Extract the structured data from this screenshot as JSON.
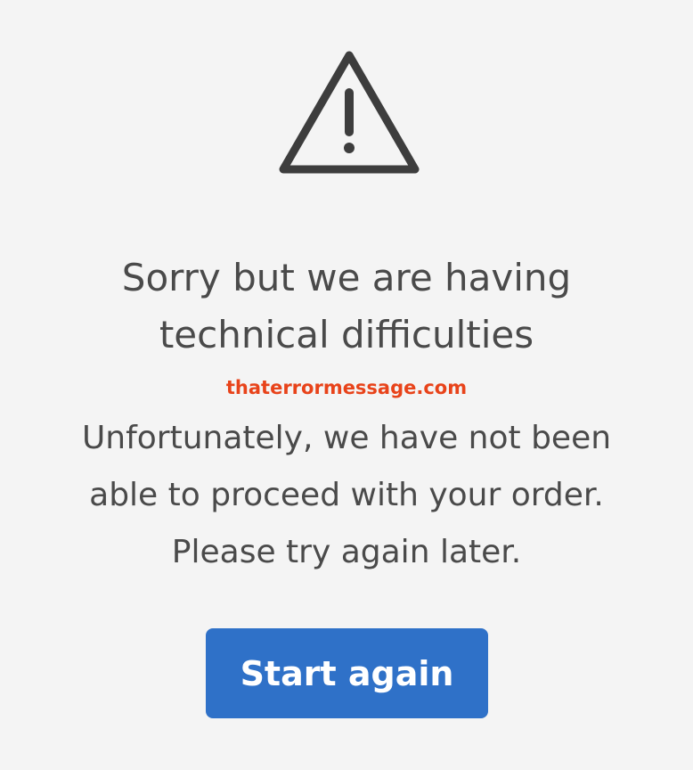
{
  "icon": {
    "name": "warning-triangle-icon",
    "color": "#3d3d3d"
  },
  "heading": {
    "line1": "Sorry but we are having",
    "line2": "technical difficulties"
  },
  "watermark": {
    "text": "thaterrormessage.com",
    "color": "#e8431a"
  },
  "message": {
    "line1": "Unfortunately, we have not been",
    "line2": "able to proceed with your order.",
    "line3": "Please try again later."
  },
  "button": {
    "label": "Start again",
    "color": "#2f71c8"
  }
}
